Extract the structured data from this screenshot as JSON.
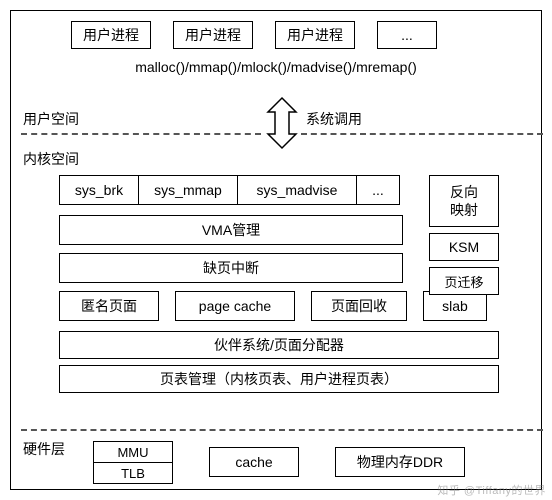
{
  "top_processes": {
    "p1": "用户进程",
    "p2": "用户进程",
    "p3": "用户进程",
    "dots": "..."
  },
  "api_line": "malloc()/mmap()/mlock()/madvise()/mremap()",
  "labels": {
    "user_space": "用户空间",
    "syscall": "系统调用",
    "kernel_space": "内核空间",
    "hardware": "硬件层"
  },
  "syscalls": {
    "s1": "sys_brk",
    "s2": "sys_mmap",
    "s3": "sys_madvise",
    "dots": "..."
  },
  "kernel": {
    "vma": "VMA管理",
    "page_fault": "缺页中断",
    "anon": "匿名页面",
    "page_cache": "page cache",
    "reclaim": "页面回收",
    "slab": "slab",
    "buddy": "伙伴系统/页面分配器",
    "pgtable": "页表管理（内核页表、用户进程页表）",
    "rmap_l1": "反向",
    "rmap_l2": "映射",
    "ksm": "KSM",
    "migrate": "页迁移"
  },
  "hardware": {
    "mmu": "MMU",
    "tlb": "TLB",
    "cache": "cache",
    "ddr": "物理内存DDR"
  },
  "watermark": "知乎 @Tiffany的世界"
}
